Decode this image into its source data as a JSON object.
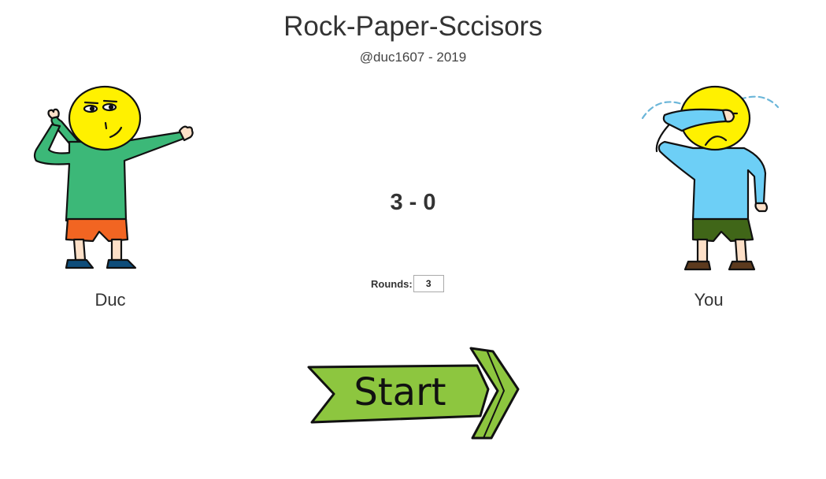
{
  "header": {
    "title": "Rock-Paper-Sccisors",
    "subtitle": "@duc1607 - 2019"
  },
  "players": {
    "left_name": "Duc",
    "right_name": "You"
  },
  "score": {
    "text": "3 - 0"
  },
  "rounds": {
    "label": "Rounds:",
    "value": "3"
  },
  "start_button": {
    "label": "Start"
  },
  "colors": {
    "face": "#fff100",
    "left_shirt": "#3cb878",
    "left_shorts": "#f26522",
    "left_shoes": "#0e4d7a",
    "right_shirt": "#6dcff6",
    "right_shorts": "#406618",
    "right_shoes": "#5c3a1e",
    "tears": "#6bb6d9",
    "button_green": "#8dc63f"
  }
}
